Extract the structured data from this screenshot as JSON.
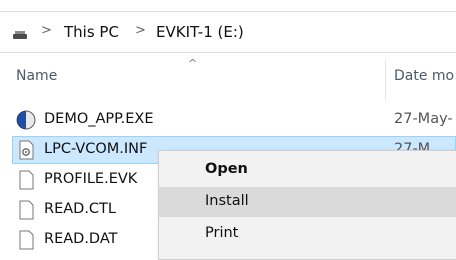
{
  "address_bar": {
    "crumbs": [
      "This PC",
      "EVKIT-1 (E:)"
    ],
    "separator": ">"
  },
  "columns": {
    "name": "Name",
    "date": "Date mo",
    "sort_indicator": "^"
  },
  "files": [
    {
      "name": "DEMO_APP.EXE",
      "date": "27-May-",
      "icon": "app-icon"
    },
    {
      "name": "LPC-VCOM.INF",
      "date": "27-M",
      "icon": "settings-file-icon",
      "selected": true
    },
    {
      "name": "PROFILE.EVK",
      "date": "",
      "icon": "document-icon"
    },
    {
      "name": "READ.CTL",
      "date": "",
      "icon": "document-icon"
    },
    {
      "name": "READ.DAT",
      "date": "",
      "icon": "document-icon"
    }
  ],
  "context_menu": {
    "items": [
      {
        "label": "Open",
        "default": true
      },
      {
        "label": "Install",
        "highlighted": true
      },
      {
        "label": "Print"
      }
    ]
  },
  "colors": {
    "selection_bg": "#cce8ff",
    "selection_border": "#99d1ff",
    "menu_bg": "#f2f2f2",
    "menu_hover": "#dadada"
  }
}
